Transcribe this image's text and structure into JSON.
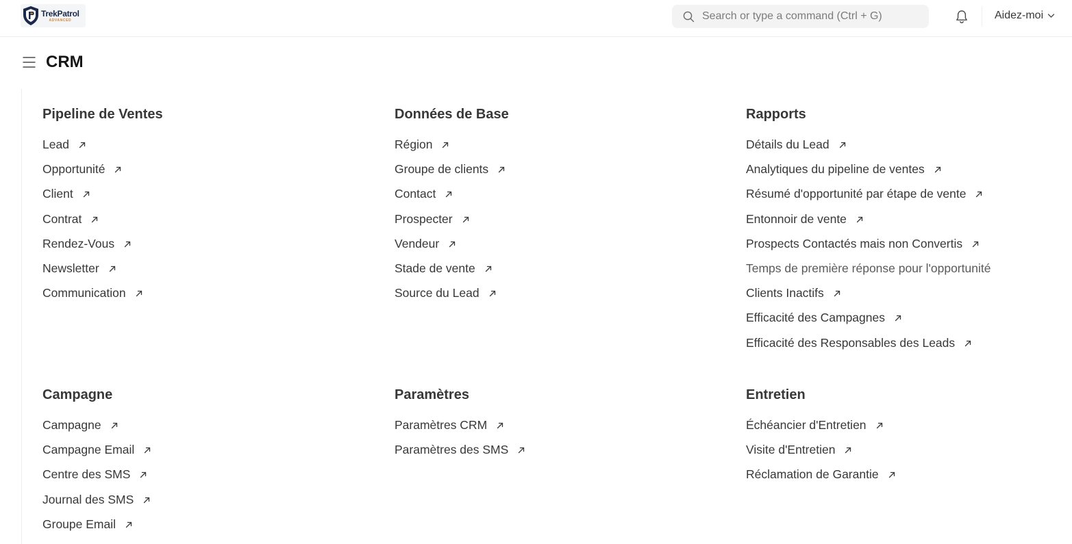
{
  "navbar": {
    "logo_name": "TrekPatrol",
    "logo_sub": "ADVANCED",
    "search_placeholder": "Search or type a command (Ctrl + G)",
    "help_label": "Aidez-moi"
  },
  "page": {
    "title": "CRM"
  },
  "sections": {
    "pipeline": {
      "title": "Pipeline de Ventes",
      "links": [
        "Lead",
        "Opportunité",
        "Client",
        "Contrat",
        "Rendez-Vous",
        "Newsletter",
        "Communication"
      ]
    },
    "donnees": {
      "title": "Données de Base",
      "links": [
        "Région",
        "Groupe de clients",
        "Contact",
        "Prospecter",
        "Vendeur",
        "Stade de vente",
        "Source du Lead"
      ]
    },
    "rapports": {
      "title": "Rapports",
      "links": [
        "Détails du Lead",
        "Analytiques du pipeline de ventes",
        "Résumé d'opportunité par étape de vente",
        "Entonnoir de vente",
        "Prospects Contactés mais non Convertis",
        "Temps de première réponse pour l'opportunité",
        "Clients Inactifs",
        "Efficacité des Campagnes",
        "Efficacité des Responsables des Leads"
      ]
    },
    "campagne": {
      "title": "Campagne",
      "links": [
        "Campagne",
        "Campagne Email",
        "Centre des SMS",
        "Journal des SMS",
        "Groupe Email"
      ]
    },
    "parametres": {
      "title": "Paramètres",
      "links": [
        "Paramètres CRM",
        "Paramètres des SMS"
      ]
    },
    "entretien": {
      "title": "Entretien",
      "links": [
        "Échéancier d'Entretien",
        "Visite d'Entretien",
        "Réclamation de Garantie"
      ]
    }
  },
  "icons": {
    "logo": "shield-logo-icon",
    "search": "search-icon",
    "notifications": "bell-icon",
    "help_dropdown": "chevron-down-icon",
    "menu": "hamburger-menu-icon",
    "link_arrow": "arrow-up-right-icon"
  }
}
